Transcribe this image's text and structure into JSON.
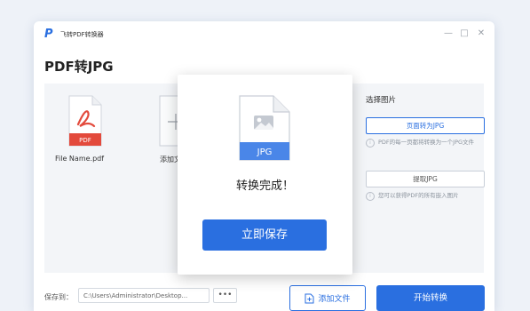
{
  "window": {
    "app_title": "飞转PDF转换器",
    "minimize": "—",
    "maximize": "□",
    "close": "✕"
  },
  "page": {
    "title": "PDF转JPG"
  },
  "files": [
    {
      "name": "File Name.pdf",
      "badge": "PDF"
    },
    {
      "name": "添加文件",
      "badge": ""
    }
  ],
  "options": {
    "title": "选择图片",
    "page_to_jpg": "页面转为JPG",
    "page_to_jpg_desc": "PDF的每一页都将转换为一个JPG文件",
    "extract_jpg": "提取JPG",
    "extract_jpg_desc": "您可以获得PDF的所有嵌入图片"
  },
  "footer": {
    "save_to_label": "保存到：",
    "path_value": "C:\\Users\\Administrator\\Desktop...",
    "browse_label": "•••",
    "add_file_label": "添加文件",
    "start_label": "开始转换"
  },
  "modal": {
    "file_badge": "JPG",
    "message": "转换完成！",
    "save_now_label": "立即保存"
  },
  "colors": {
    "accent": "#2a6fe0",
    "pdf_red": "#e34a3c"
  }
}
